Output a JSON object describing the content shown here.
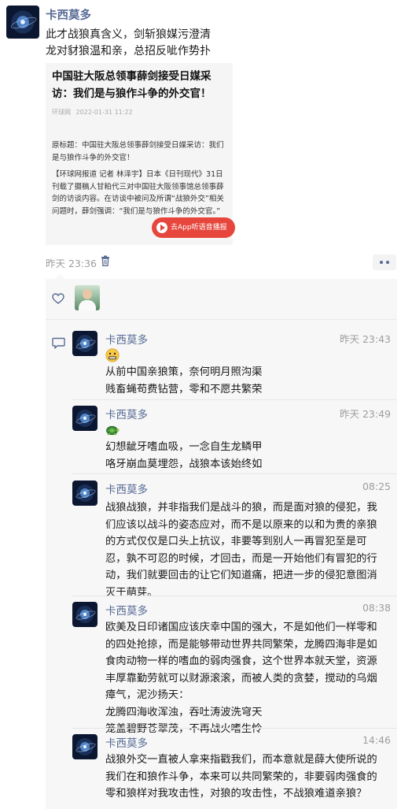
{
  "post": {
    "author": "卡西莫多",
    "text_lines": [
      "此才战狼真含义，剑斩狼媒污澄清",
      "龙对豺狼温和亲，总招反呲作势扑"
    ],
    "time": "昨天 23:36"
  },
  "card": {
    "title": "中国驻大阪总领事薛剑接受日媒采访：我们是与狼作斗争的外交官！",
    "meta_source": "环球网",
    "meta_date": "2022-01-31 11:22",
    "body_1": "原标题：中国驻大阪总领事薛剑接受日媒采访：我们是与狼作斗争的外交官！",
    "body_2": "【环球网报道 记者 林泽宇】日本《日刊现代》31日刊载了摄稿人甘粕代三对中国驻大阪领事馆总领事薛剑的访谈内容。在访谈中被问及所谓“战狼外交”相关问题时，薛剑强调：“我们是与狼作斗争的外交官。”",
    "app_button": "去App听语音播报"
  },
  "icons": {
    "trash": "trash-icon",
    "more": "more-dots-icon",
    "heart": "heart-outline-icon",
    "comment": "comment-bubble-icon",
    "emoji_1": "grimace-emoji",
    "emoji_2": "turtle-emoji"
  },
  "colors": {
    "name_blue": "#576b95",
    "time_gray": "#9d9d9d",
    "panel_bg": "#f7f7f7",
    "red_pill": "#e6463c"
  },
  "comments": [
    {
      "author": "卡西莫多",
      "time": "昨天 23:43",
      "lines": [
        "从前中国亲狼策，奈何明月照沟渠",
        "贱畜蝇苟费钻营，零和不愿共繁荣"
      ]
    },
    {
      "author": "卡西莫多",
      "time": "昨天 23:49",
      "lines": [
        "幻想龇牙嗜血吸，一念自生龙鳞甲",
        "咯牙崩血莫埋怨，战狼本该始终如"
      ]
    },
    {
      "author": "卡西莫多",
      "time": "08:25",
      "lines": [
        "战狼战狼，并非指我们是战斗的狼，而是面对狼的侵犯，我",
        "们应该以战斗的姿态应对，而不是以原来的以和为贵的亲狼",
        "的方式仅仅是口头上抗议，非要等到别人一再冒犯至是可",
        "忍，孰不可忍的时候，才回击，而是一开始他们有冒犯的行",
        "动，我们就要回击的让它们知道痛，把进一步的侵犯意图消",
        "灭于萌芽。"
      ]
    },
    {
      "author": "卡西莫多",
      "time": "08:38",
      "lines": [
        "欧美及日印诸国应该庆幸中国的强大，不是如他们一样零和",
        "的四处抢掠，而是能够带动世界共同繁荣，龙腾四海非是如",
        "食肉动物一样的嗜血的弱肉强食，这个世界本就天堂，资源",
        "丰厚靠勤劳就可以财源滚滚，而被人类的贪婪，搅动的乌烟",
        "瘴气，泥沙扬天：",
        "龙腾四海收浑浊，吞吐涛波洗穹天",
        "笼盖碧野苍翠茂，不再战火嗜生怜"
      ]
    },
    {
      "author": "卡西莫多",
      "time": "14:46",
      "lines": [
        "战狼外交一直被人拿来指戳我们，而本意就是薛大使所说的",
        "我们在和狼作斗争，本来可以共同繁荣的，非要弱肉强食的",
        "零和狼样对我攻击性，对狼的攻击性，不战狼难道亲狼？"
      ]
    }
  ]
}
